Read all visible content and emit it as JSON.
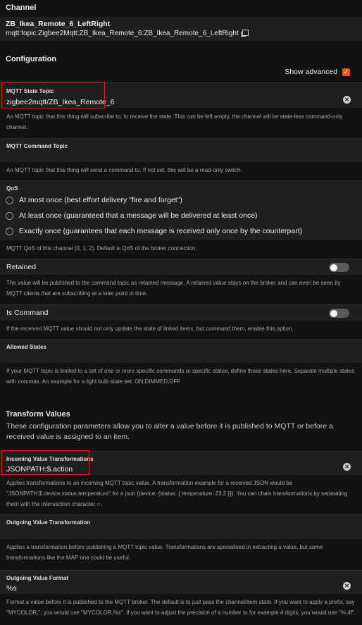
{
  "channel": {
    "header": "Channel",
    "name": "ZB_Ikea_Remote_6_LeftRight",
    "uid": "mqtt:topic:Zigbee2Mqtt:ZB_Ikea_Remote_6:ZB_Ikea_Remote_6_LeftRight"
  },
  "configuration": {
    "header": "Configuration",
    "show_advanced_label": "Show advanced",
    "show_advanced_checked": true
  },
  "state_topic": {
    "label": "MQTT State Topic",
    "value": "zigbee2mqtt/ZB_Ikea_Remote_6",
    "help": "An MQTT topic that this thing will subscribe to, to receive the state. This can be left empty, the channel will be state-less command-only channel."
  },
  "command_topic": {
    "label": "MQTT Command Topic",
    "value": "",
    "help": "An MQTT topic that this thing will send a command to. If not set, this will be a read-only switch."
  },
  "qos": {
    "label": "QoS",
    "options": [
      "At most once (best effort delivery \"fire and forget\")",
      "At least once (guaranteed that a message will be delivered at least once)",
      "Exactly once (guarantees that each message is received only once by the counterpart)"
    ],
    "help": "MQTT QoS of this channel (0, 1, 2). Default is QoS of the broker connection."
  },
  "retained": {
    "label": "Retained",
    "help": "The value will be published to the command topic as retained message. A retained value stays on the broker and can even be seen by MQTT clients that are subscribing at a later point in time."
  },
  "is_command": {
    "label": "Is Command",
    "help": "If the received MQTT value should not only update the state of linked items, but command them, enable this option."
  },
  "allowed_states": {
    "label": "Allowed States",
    "value": "",
    "help": "If your MQTT topic is limited to a set of one or more specific commands or specific states, define those states here. Separate multiple states with commas. An example for a light bulb state set: ON,DIMMED,OFF"
  },
  "transform": {
    "header": "Transform Values",
    "description": "These configuration parameters allow you to alter a value before it is published to MQTT or before a received value is assigned to an item."
  },
  "incoming_transform": {
    "label": "Incoming Value Transformations",
    "value": "JSONPATH:$.action",
    "help": "Applies transformations to an incoming MQTT topic value. A transformation example for a received JSON would be \"JSONPATH:$.device.status.temperature\" for a json {device: {status: { temperature: 23.2 }}}. You can chain transformations by separating them with the intersection character ∩."
  },
  "outgoing_transform": {
    "label": "Outgoing Value Transformation",
    "value": "",
    "help": "Applies a transformation before publishing a MQTT topic value. Transformations are specialised in extracting a value, but some transformations like the MAP one could be useful."
  },
  "outgoing_format": {
    "label": "Outgoing Value Format",
    "value": "%s",
    "help": "Format a value before it is published to the MQTT broker. The default is to just pass the channel/item state. If you want to apply a prefix, say \"MYCOLOR,\", you would use \"MYCOLOR,%s\". If you want to adjust the precision of a number to for example 4 digits, you would use \"%.4f\"."
  },
  "colors": {
    "background": "#121212",
    "field": "#1f1f1f",
    "accent": "#e8551d",
    "highlight": "#e01c1c"
  }
}
